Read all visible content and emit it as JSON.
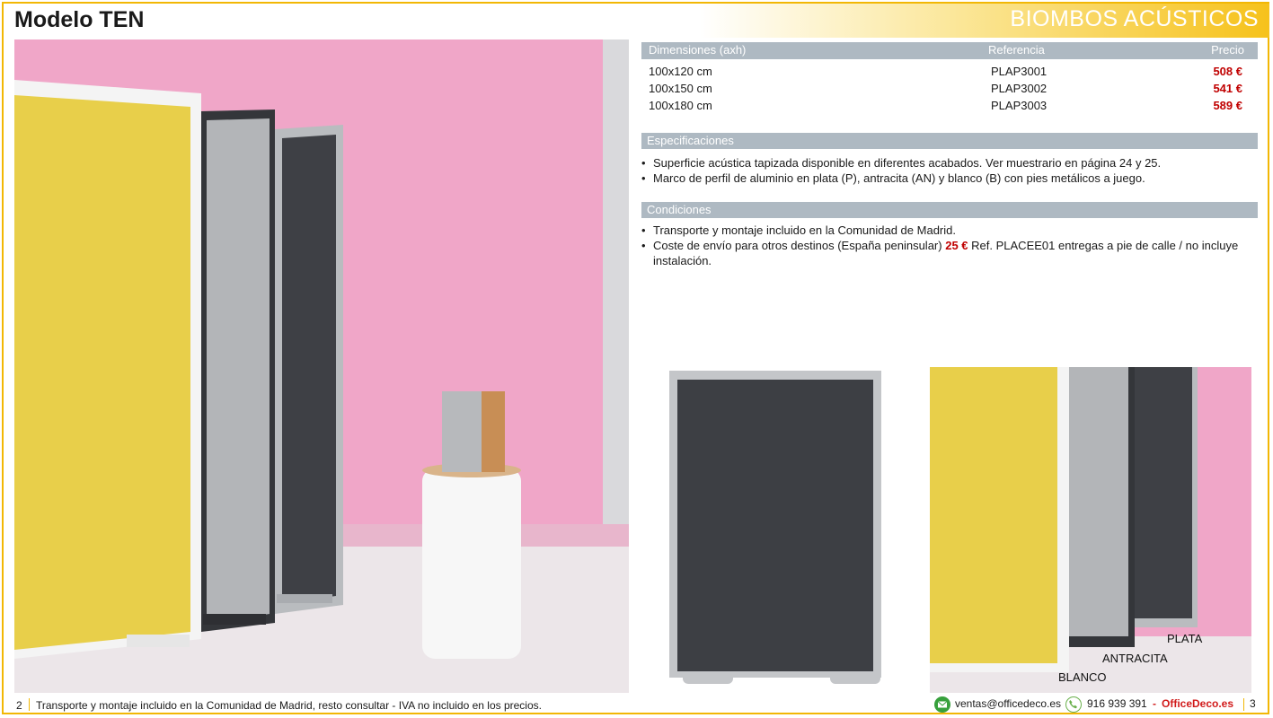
{
  "header": {
    "model_title": "Modelo TEN",
    "category_title": "BIOMBOS ACÚSTICOS"
  },
  "price_table": {
    "columns": [
      "Dimensiones (axh)",
      "Referencia",
      "Precio"
    ],
    "rows": [
      {
        "dim": "100x120 cm",
        "ref": "PLAP3001",
        "price": "508 €"
      },
      {
        "dim": "100x150 cm",
        "ref": "PLAP3002",
        "price": "541 €"
      },
      {
        "dim": "100x180 cm",
        "ref": "PLAP3003",
        "price": "589 €"
      }
    ]
  },
  "specs": {
    "heading": "Especificaciones",
    "items": [
      "Superficie acústica tapizada disponible en diferentes acabados. Ver muestrario en página 24 y 25.",
      "Marco de perfil de aluminio en plata (P), antracita (AN) y blanco (B) con pies metálicos a juego."
    ]
  },
  "conditions": {
    "heading": "Condiciones",
    "item1": "Transporte y montaje incluido en la Comunidad de Madrid.",
    "item2_pre": "Coste de envío para otros destinos (España peninsular)",
    "item2_price": "25 €",
    "item2_post": "Ref. PLACEE01 entregas a pie de calle / no incluye instalación."
  },
  "frame_labels": {
    "plata": "PLATA",
    "antracita": "ANTRACITA",
    "blanco": "BLANCO"
  },
  "footer": {
    "page_left": "2",
    "note": "Transporte y montaje incluido en la Comunidad de Madrid, resto consultar - IVA no incluido en los precios.",
    "email": "ventas@officedeco.es",
    "phone": "916 939 391",
    "dash": "-",
    "brand": "OfficeDeco.es",
    "page_right": "3"
  },
  "colors": {
    "accent": "#f2b705",
    "price_red": "#c00000",
    "section_bar": "#aeb9c2",
    "pink_wall": "#f0a6c8",
    "yellow_panel": "#e8cf4a",
    "anthracite_felt": "#3d3f44"
  }
}
